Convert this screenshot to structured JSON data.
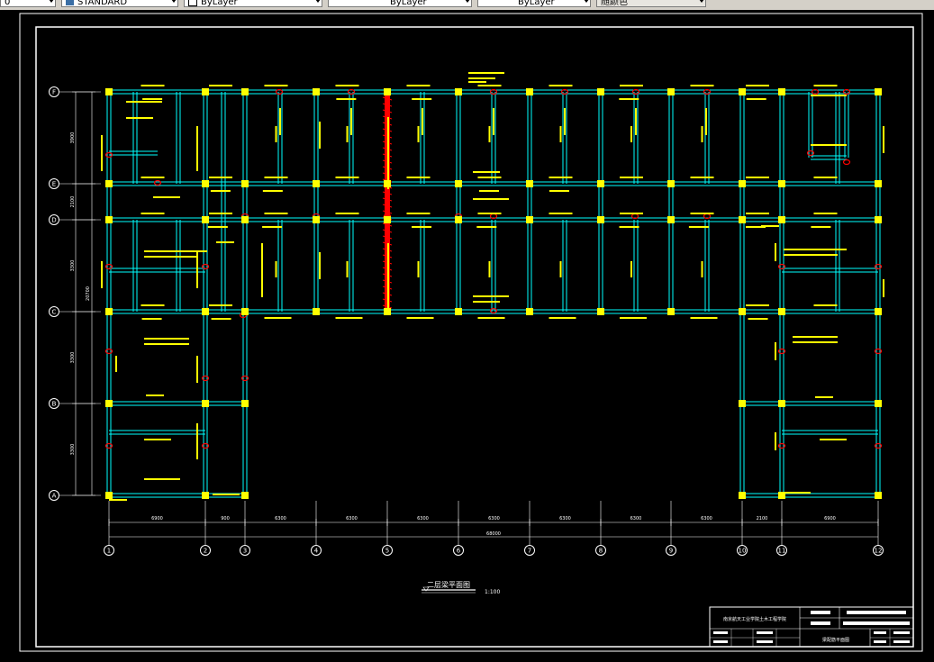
{
  "toolbar": {
    "dropdowns": [
      {
        "id": "layer-combo",
        "value": "0"
      },
      {
        "id": "style-combo",
        "value": "STANDARD"
      },
      {
        "id": "color-combo",
        "value": "ByLayer"
      },
      {
        "id": "linetype-combo",
        "value": "ByLayer"
      },
      {
        "id": "lineweight-combo",
        "value": "ByLayer"
      },
      {
        "id": "plotstyle-combo",
        "value": "随颜色"
      }
    ]
  },
  "drawing": {
    "grid_rows": [
      "F",
      "E",
      "D",
      "C",
      "B",
      "A"
    ],
    "grid_cols": [
      "1",
      "2",
      "3",
      "4",
      "5",
      "6",
      "7",
      "8",
      "9",
      "10",
      "11",
      "12"
    ],
    "vertical_dims": [
      "3900",
      "2100",
      "3300",
      "3300",
      "3300",
      "3300"
    ],
    "vertical_total": "20700",
    "horizontal_dims": [
      "6900",
      "900",
      "6300",
      "6300",
      "6300",
      "6300",
      "6300",
      "6300",
      "6300",
      "2100",
      "6900"
    ],
    "horizontal_total": "68000",
    "plan_title": "二层梁平面图",
    "plan_scale": "1:100",
    "title_block": {
      "school": "南京航天工业学院土木工程学院",
      "sheet_title": "梁配筋平面图"
    }
  },
  "colors": {
    "beam": "#00ffff",
    "column": "#ffff00",
    "grid": "#ffffff",
    "annotation": "#ffff00",
    "highlight": "#ff0000",
    "border": "#ffffff"
  }
}
